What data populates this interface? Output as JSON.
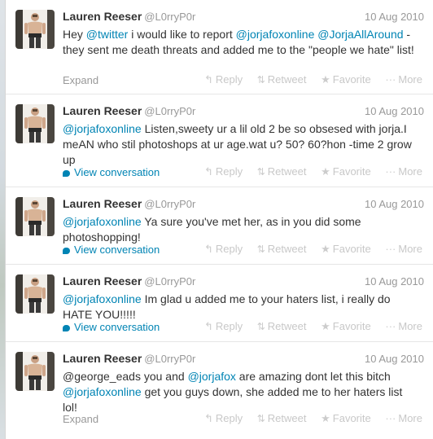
{
  "colors": {
    "link": "#0084b4",
    "muted": "#999999",
    "text": "#333333",
    "action": "#c8c8c8"
  },
  "icons": {
    "reply": "reply-arrow-icon",
    "retweet": "retweet-icon",
    "favorite": "star-icon",
    "more": "dots-icon",
    "conversation": "speech-bubble-icon"
  },
  "tweets": [
    {
      "name": "Lauren Reeser",
      "screen_name": "@L0rryP0r",
      "date": "10 Aug 2010",
      "segments": [
        {
          "t": "Hey "
        },
        {
          "t": "@twitter",
          "m": true
        },
        {
          "t": " i would like to report "
        },
        {
          "t": "@jorjafoxonline",
          "m": true
        },
        {
          "t": " "
        },
        {
          "t": "@JorjaAllAround",
          "m": true
        },
        {
          "t": " - they sent me death threats and added me to the \"people we hate\" list!"
        }
      ],
      "footer_link": "Expand",
      "footer_type": "expand",
      "actions": {
        "reply": "Reply",
        "retweet": "Retweet",
        "favorite": "Favorite",
        "more": "More"
      }
    },
    {
      "name": "Lauren Reeser",
      "screen_name": "@L0rryP0r",
      "date": "10 Aug 2010",
      "segments": [
        {
          "t": "@jorjafoxonline",
          "m": true
        },
        {
          "t": " Listen,sweety ur a lil old 2 be so obsesed with jorja.I meAN who stil photoshops at ur age.wat u? 50? 60?hon -time 2 grow up"
        }
      ],
      "footer_link": "View conversation",
      "footer_type": "conversation",
      "actions": {
        "reply": "Reply",
        "retweet": "Retweet",
        "favorite": "Favorite",
        "more": "More"
      }
    },
    {
      "name": "Lauren Reeser",
      "screen_name": "@L0rryP0r",
      "date": "10 Aug 2010",
      "segments": [
        {
          "t": "@jorjafoxonline",
          "m": true
        },
        {
          "t": " Ya sure you've met her, as in you did some photoshopping!"
        }
      ],
      "footer_link": "View conversation",
      "footer_type": "conversation",
      "actions": {
        "reply": "Reply",
        "retweet": "Retweet",
        "favorite": "Favorite",
        "more": "More"
      }
    },
    {
      "name": "Lauren Reeser",
      "screen_name": "@L0rryP0r",
      "date": "10 Aug 2010",
      "segments": [
        {
          "t": "@jorjafoxonline",
          "m": true
        },
        {
          "t": " Im glad u added me to your haters list, i really do HATE YOU!!!!!"
        }
      ],
      "footer_link": "View conversation",
      "footer_type": "conversation",
      "actions": {
        "reply": "Reply",
        "retweet": "Retweet",
        "favorite": "Favorite",
        "more": "More"
      }
    },
    {
      "name": "Lauren Reeser",
      "screen_name": "@L0rryP0r",
      "date": "10 Aug 2010",
      "segments": [
        {
          "t": "@george_eads you and "
        },
        {
          "t": "@jorjafox",
          "m": true
        },
        {
          "t": " are amazing dont let this bitch "
        },
        {
          "t": "@jorjafoxonline",
          "m": true
        },
        {
          "t": " get you guys down, she added me to her haters list lol!"
        }
      ],
      "footer_link": "Expand",
      "footer_type": "expand",
      "actions": {
        "reply": "Reply",
        "retweet": "Retweet",
        "favorite": "Favorite",
        "more": "More"
      }
    }
  ]
}
